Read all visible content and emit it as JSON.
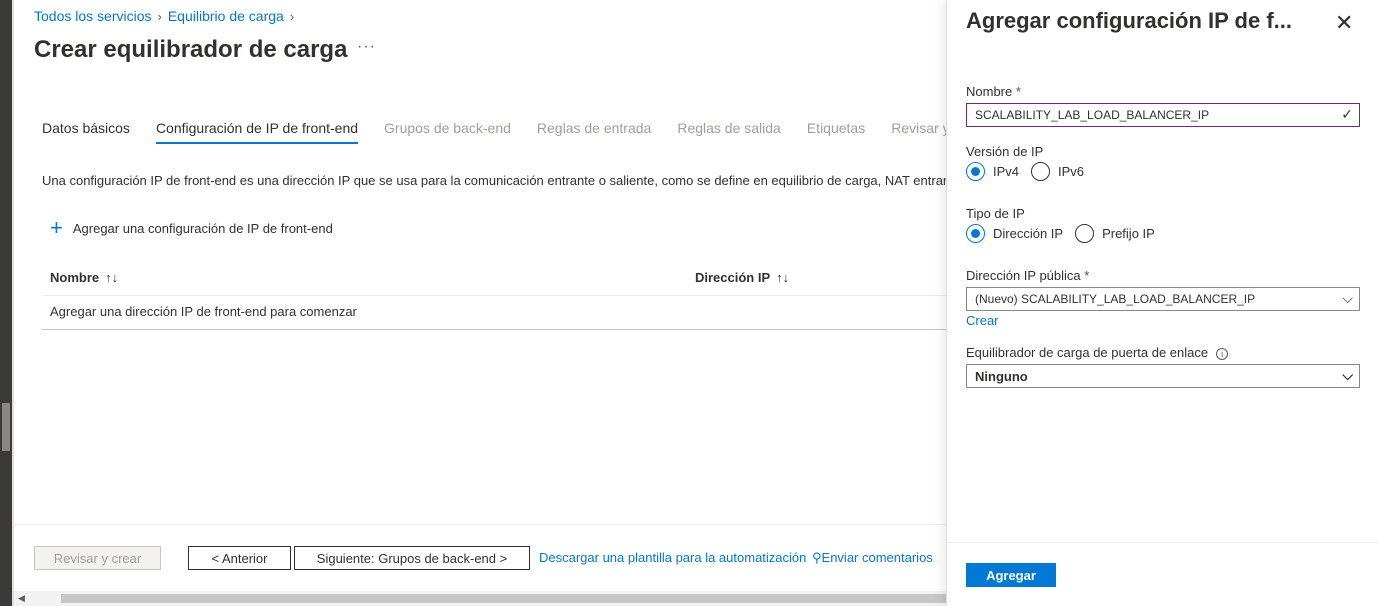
{
  "breadcrumb": {
    "items": [
      "Todos los servicios",
      "Equilibrio de carga"
    ]
  },
  "page": {
    "title": "Crear equilibrador de carga",
    "more": "···"
  },
  "tabs": [
    {
      "label": "Datos básicos",
      "state": "done"
    },
    {
      "label": "Configuración de IP de front-end",
      "state": "active"
    },
    {
      "label": "Grupos de back-end",
      "state": "disabled"
    },
    {
      "label": "Reglas de entrada",
      "state": "disabled"
    },
    {
      "label": "Reglas de salida",
      "state": "disabled"
    },
    {
      "label": "Etiquetas",
      "state": "disabled"
    },
    {
      "label": "Revisar y c",
      "state": "disabled"
    }
  ],
  "description": "Una configuración IP de front-end es una dirección IP que se usa para la comunicación entrante o saliente, como se define en equilibrio de carga, NAT entrant",
  "add_config": {
    "label": "Agregar una configuración de IP de front-end",
    "icon": "plus-icon"
  },
  "table": {
    "columns": [
      "Nombre",
      "Dirección IP"
    ],
    "sort_glyph": "↑↓",
    "empty_text": "Agregar una dirección IP de front-end para comenzar"
  },
  "footer": {
    "review": "Revisar y crear",
    "previous": "< Anterior",
    "next": "Siguiente: Grupos de back-end >",
    "download": "Descargar una plantilla para la automatización",
    "feedback": "Enviar comentarios"
  },
  "panel": {
    "title": "Agregar configuración IP de f...",
    "name_label": "Nombre",
    "name_value": "SCALABILITY_LAB_LOAD_BALANCER_IP",
    "ip_version_label": "Versión de IP",
    "ip_version_options": [
      "IPv4",
      "IPv6"
    ],
    "ip_version_selected": "IPv4",
    "ip_type_label": "Tipo de IP",
    "ip_type_options": [
      "Dirección IP",
      "Prefijo IP"
    ],
    "ip_type_selected": "Dirección IP",
    "public_ip_label": "Dirección IP pública",
    "public_ip_value": "(Nuevo) SCALABILITY_LAB_LOAD_BALANCER_IP",
    "create_link": "Crear",
    "gateway_label": "Equilibrador de carga de puerta de enlace",
    "gateway_value": "Ninguno",
    "add_button": "Agregar",
    "required_mark": "*"
  },
  "colors": {
    "accent": "#0078d4",
    "required": "#a4262c"
  }
}
